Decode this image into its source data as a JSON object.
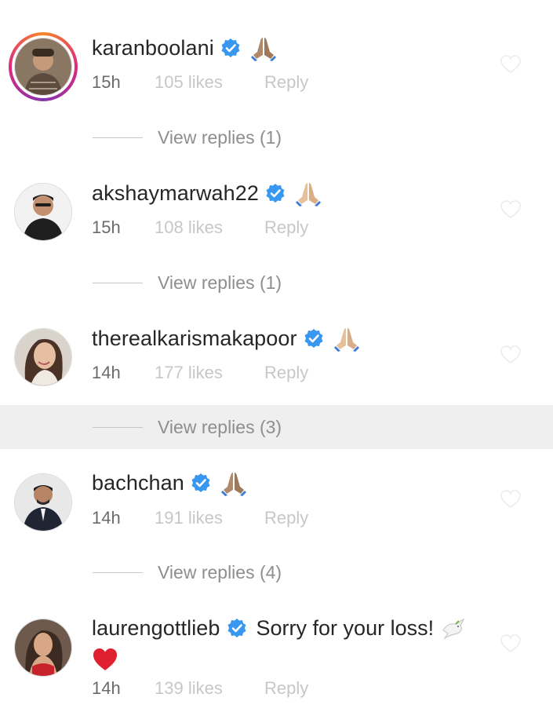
{
  "comments": [
    {
      "username": "karanboolani",
      "text": "",
      "time": "15h",
      "likes": "105 likes",
      "reply": "Reply",
      "emoji": "folded-hands",
      "story_ring": true,
      "replies_label": "View replies (1)"
    },
    {
      "username": "akshaymarwah22",
      "text": "",
      "time": "15h",
      "likes": "108 likes",
      "reply": "Reply",
      "emoji": "folded-hands",
      "story_ring": false,
      "replies_label": "View replies (1)"
    },
    {
      "username": "therealkarismakapoor",
      "text": "",
      "time": "14h",
      "likes": "177 likes",
      "reply": "Reply",
      "emoji": "folded-hands",
      "story_ring": false,
      "replies_label": "View replies (3)"
    },
    {
      "username": "bachchan",
      "text": "",
      "time": "14h",
      "likes": "191 likes",
      "reply": "Reply",
      "emoji": "folded-hands",
      "story_ring": false,
      "replies_label": "View replies (4)"
    },
    {
      "username": "laurengottlieb",
      "text": "Sorry for your loss!",
      "time": "14h",
      "likes": "139 likes",
      "reply": "Reply",
      "emoji": "dove",
      "second_line_emoji": "red-heart",
      "story_ring": false
    }
  ],
  "colors": {
    "verified": "#3897f0",
    "highlight_row": "#efefef",
    "muted_text": "#c7c7c7",
    "heart_red": "#e0202e"
  }
}
